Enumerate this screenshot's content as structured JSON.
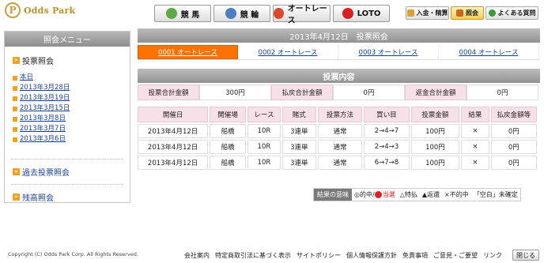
{
  "header": {
    "logo_text": "Odds Park",
    "main_nav": [
      "競 馬",
      "競 輪",
      "オートレース",
      "LOTO"
    ],
    "util_nav": [
      "入金・精算",
      "照会",
      "よくある質問"
    ]
  },
  "sidebar": {
    "title": "照会メニュー",
    "section_title": "投票照会",
    "dates": [
      "本日",
      "2013年3月28日",
      "2013年3月19日",
      "2013年3月15日",
      "2013年3月8日",
      "2013年3月7日",
      "2013年3月6日"
    ],
    "past_link": "過去投票照会",
    "balance_link": "残高照会"
  },
  "main": {
    "page_title": "2013年4月12日　投票照会",
    "tabs": [
      "0001 オートレース",
      "0002 オートレース",
      "0003 オートレース",
      "0004 オートレース"
    ],
    "section_title": "投票内容",
    "summary": {
      "bet_total_label": "投票合計金額",
      "bet_total": "300円",
      "payout_total_label": "払戻合計金額",
      "payout_total": "0円",
      "refund_total_label": "返金合計金額",
      "refund_total": "0円"
    },
    "table": {
      "headers": [
        "開催日",
        "開催場",
        "レース",
        "賭式",
        "投票方法",
        "買い目",
        "投票金額",
        "結果",
        "払戻金額等"
      ],
      "rows": [
        [
          "2013年4月12日",
          "船橋",
          "10R",
          "3連単",
          "通常",
          "2→4→7",
          "100円",
          "×",
          "0円"
        ],
        [
          "2013年4月12日",
          "船橋",
          "10R",
          "3連単",
          "通常",
          "2→4→3",
          "100円",
          "×",
          "0円"
        ],
        [
          "2013年4月12日",
          "船橋",
          "10R",
          "3連単",
          "通常",
          "6→7→8",
          "100円",
          "×",
          "0円"
        ]
      ]
    },
    "legend": {
      "label": "結果の意味",
      "hit": "◎的中/",
      "win": "当選",
      "special": "△特払",
      "refund": "▲返還",
      "miss": "×不的中",
      "blank": "「空白」未確定"
    }
  },
  "footer": {
    "copyright": "Copyright (C) Odds Park Corp. All Rights Reserved.",
    "links": [
      "会社案内",
      "特定商取引法に基づく表示",
      "サイトポリシー",
      "個人情報保護方針",
      "免責事項",
      "ご意見・ご要望",
      "リンク"
    ],
    "close_label": "閉じる"
  }
}
